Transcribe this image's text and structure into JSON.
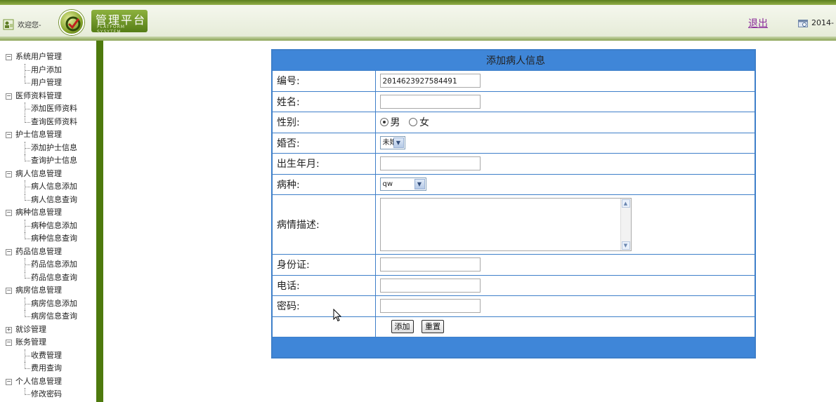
{
  "header": {
    "welcome": "欢迎您-",
    "logo_title": "管理平台",
    "logo_subtitle": "PLATFORM SYSYTEM",
    "logout": "退出",
    "date": "2014-"
  },
  "sidebar": {
    "groups": [
      {
        "label": "系统用户管理",
        "items": [
          "用户添加",
          "用户管理"
        ]
      },
      {
        "label": "医师资料管理",
        "items": [
          "添加医师资料",
          "查询医师资料"
        ]
      },
      {
        "label": "护士信息管理",
        "items": [
          "添加护士信息",
          "查询护士信息"
        ]
      },
      {
        "label": "病人信息管理",
        "items": [
          "病人信息添加",
          "病人信息查询"
        ]
      },
      {
        "label": "病种信息管理",
        "items": [
          "病种信息添加",
          "病种信息查询"
        ]
      },
      {
        "label": "药品信息管理",
        "items": [
          "药品信息添加",
          "药品信息查询"
        ]
      },
      {
        "label": "病房信息管理",
        "items": [
          "病房信息添加",
          "病房信息查询"
        ]
      },
      {
        "label": "就诊管理",
        "items": []
      },
      {
        "label": "账务管理",
        "items": [
          "收费管理",
          "费用查询"
        ]
      },
      {
        "label": "个人信息管理",
        "items": [
          "修改密码"
        ]
      }
    ]
  },
  "form": {
    "title": "添加病人信息",
    "labels": {
      "id": "编号:",
      "name": "姓名:",
      "gender": "性别:",
      "married": "婚否:",
      "birth": "出生年月:",
      "disease": "病种:",
      "description": "病情描述:",
      "idcard": "身份证:",
      "phone": "电话:",
      "password": "密码:"
    },
    "values": {
      "id": "2014623927584491",
      "name": "",
      "birth": "",
      "idcard": "",
      "phone": "",
      "password": ""
    },
    "gender_options": [
      "男",
      "女"
    ],
    "gender_selected": "男",
    "married_selected": "未婚",
    "disease_selected": "qw",
    "buttons": {
      "add": "添加",
      "reset": "重置"
    }
  },
  "colors": {
    "header_green": "#5b7f1e",
    "sidebar_bar": "#4e7a0e",
    "form_blue": "#3f86d8",
    "logout": "#8a2a9a"
  }
}
